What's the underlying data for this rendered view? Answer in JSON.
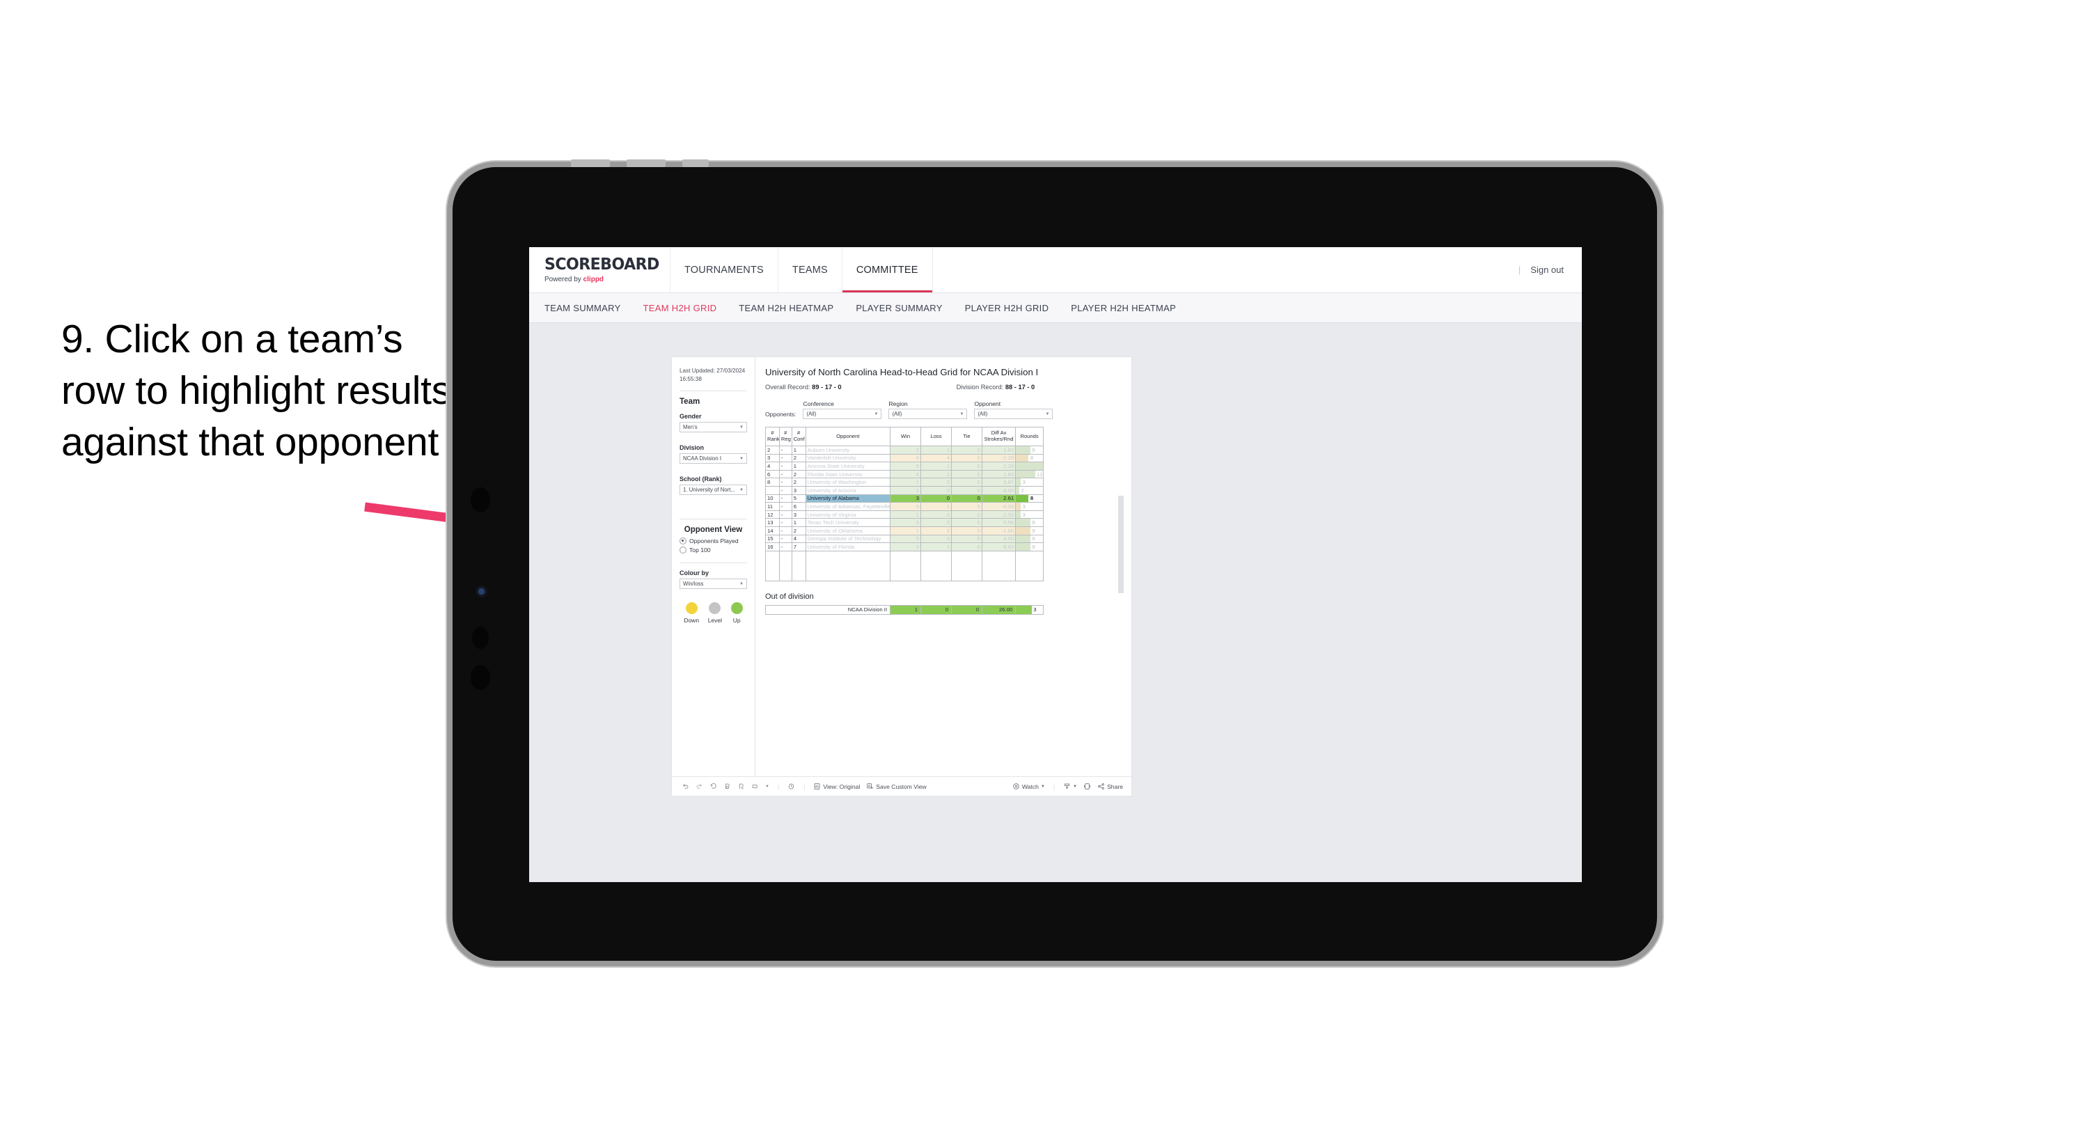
{
  "caption": {
    "text": "9. Click on a team’s row to highlight results against that opponent"
  },
  "colors": {
    "brand_pink": "#e8365d",
    "accent_nav": "#d93757",
    "select_blue": "#8fbdd6",
    "select_green": "#8ccc55",
    "win_green": "#e4eedd",
    "loss_cream": "#f8eed7",
    "arrow_pink": "#ed3a6b"
  },
  "appbar": {
    "logo_word": "SCOREBOARD",
    "logo_powered_prefix": "Powered by ",
    "logo_brand": "clippd",
    "nav": [
      {
        "label": "TOURNAMENTS",
        "active": false
      },
      {
        "label": "TEAMS",
        "active": false
      },
      {
        "label": "COMMITTEE",
        "active": true
      }
    ],
    "divider": "|",
    "signout": "Sign out"
  },
  "subnav": {
    "items": [
      {
        "label": "TEAM SUMMARY",
        "active": false
      },
      {
        "label": "TEAM H2H GRID",
        "active": true
      },
      {
        "label": "TEAM H2H HEATMAP",
        "active": false
      },
      {
        "label": "PLAYER SUMMARY",
        "active": false
      },
      {
        "label": "PLAYER H2H GRID",
        "active": false
      },
      {
        "label": "PLAYER H2H HEATMAP",
        "active": false
      }
    ]
  },
  "sidebar": {
    "last_updated_label": "Last Updated: 27/03/2024",
    "last_updated_time": "16:55:38",
    "team_heading": "Team",
    "gender_label": "Gender",
    "gender_value": "Men’s",
    "division_label": "Division",
    "division_value": "NCAA Division I",
    "school_label": "School (Rank)",
    "school_value": "1. University of Nort...",
    "opponent_view_heading": "Opponent View",
    "opponent_view_options": [
      {
        "label": "Opponents Played",
        "selected": true
      },
      {
        "label": "Top 100",
        "selected": false
      }
    ],
    "colour_by_label": "Colour by",
    "colour_by_value": "Win/loss",
    "legend": [
      {
        "label": "Down",
        "color": "#f2d33c"
      },
      {
        "label": "Level",
        "color": "#c4c4c4"
      },
      {
        "label": "Up",
        "color": "#8dc850"
      }
    ]
  },
  "viz": {
    "title": "University of North Carolina Head-to-Head Grid for NCAA Division I",
    "overall_record_label": "Overall Record: ",
    "overall_record_value": "89 - 17 - 0",
    "division_record_label": "Division Record: ",
    "division_record_value": "88 - 17 - 0",
    "opponents_label": "Opponents:",
    "filters": [
      {
        "caption": "Conference",
        "value": "(All)"
      },
      {
        "caption": "Region",
        "value": "(All)"
      },
      {
        "caption": "Opponent",
        "value": "(All)"
      }
    ],
    "out_of_division_heading": "Out of division"
  },
  "chart_data": {
    "type": "table",
    "title": "University of North Carolina Head-to-Head Grid for NCAA Division I",
    "columns": [
      "# Rank",
      "# Reg",
      "# Conf",
      "Opponent",
      "Win",
      "Loss",
      "Tie",
      "Diff Av Strokes/Rnd",
      "Rounds"
    ],
    "column_header_lines": [
      [
        "#",
        "Rank"
      ],
      [
        "#",
        "Reg"
      ],
      [
        "#",
        "Conf"
      ],
      [
        "Opponent",
        ""
      ],
      [
        "Win",
        ""
      ],
      [
        "Loss",
        ""
      ],
      [
        "Tie",
        ""
      ],
      [
        "Diff Av",
        "Strokes/Rnd"
      ],
      [
        "Rounds",
        ""
      ]
    ],
    "rounds_max": 17,
    "rows": [
      {
        "rank": "2",
        "reg": "-",
        "conf": "1",
        "opponent": "Auburn University",
        "win": "2",
        "loss": "1",
        "tie": "0",
        "diff": "1.67",
        "rounds": "9",
        "rounds_n": 9,
        "tone": "win",
        "selected": false
      },
      {
        "rank": "3",
        "reg": "-",
        "conf": "2",
        "opponent": "Vanderbilt University",
        "win": "0",
        "loss": "4",
        "tie": "0",
        "diff": "-2.29",
        "rounds": "8",
        "rounds_n": 8,
        "tone": "loss",
        "selected": false
      },
      {
        "rank": "4",
        "reg": "-",
        "conf": "1",
        "opponent": "Arizona State University",
        "win": "5",
        "loss": "1",
        "tie": "0",
        "diff": "2.28",
        "rounds": "17",
        "rounds_n": 17,
        "tone": "win",
        "selected": false
      },
      {
        "rank": "6",
        "reg": "-",
        "conf": "2",
        "opponent": "Florida State University",
        "win": "4",
        "loss": "2",
        "tie": "0",
        "diff": "1.83",
        "rounds": "12",
        "rounds_n": 12,
        "tone": "win",
        "selected": false
      },
      {
        "rank": "8",
        "reg": "-",
        "conf": "2",
        "opponent": "University of Washington",
        "win": "1",
        "loss": "0",
        "tie": "0",
        "diff": "3.67",
        "rounds": "3",
        "rounds_n": 3,
        "tone": "win",
        "selected": false
      },
      {
        "rank": "",
        "reg": "-",
        "conf": "3",
        "opponent": "University of Arizona",
        "win": "1",
        "loss": "0",
        "tie": "0",
        "diff": "9.00",
        "rounds": "2",
        "rounds_n": 2,
        "tone": "win",
        "selected": false
      },
      {
        "rank": "10",
        "reg": "-",
        "conf": "5",
        "opponent": "University of Alabama",
        "win": "3",
        "loss": "0",
        "tie": "0",
        "diff": "2.61",
        "rounds": "8",
        "rounds_n": 8,
        "tone": "win",
        "selected": true
      },
      {
        "rank": "11",
        "reg": "-",
        "conf": "6",
        "opponent": "University of Arkansas, Fayetteville",
        "win": "0",
        "loss": "1",
        "tie": "0",
        "diff": "-4.33",
        "rounds": "3",
        "rounds_n": 3,
        "tone": "loss",
        "selected": false
      },
      {
        "rank": "12",
        "reg": "-",
        "conf": "3",
        "opponent": "University of Virginia",
        "win": "1",
        "loss": "0",
        "tie": "0",
        "diff": "2.33",
        "rounds": "3",
        "rounds_n": 3,
        "tone": "win",
        "selected": false
      },
      {
        "rank": "13",
        "reg": "-",
        "conf": "1",
        "opponent": "Texas Tech University",
        "win": "3",
        "loss": "0",
        "tie": "0",
        "diff": "5.56",
        "rounds": "9",
        "rounds_n": 9,
        "tone": "win",
        "selected": false
      },
      {
        "rank": "14",
        "reg": "-",
        "conf": "2",
        "opponent": "University of Oklahoma",
        "win": "1",
        "loss": "2",
        "tie": "0",
        "diff": "-1.00",
        "rounds": "9",
        "rounds_n": 9,
        "tone": "loss",
        "selected": false
      },
      {
        "rank": "15",
        "reg": "-",
        "conf": "4",
        "opponent": "Georgia Institute of Technology",
        "win": "5",
        "loss": "0",
        "tie": "0",
        "diff": "4.50",
        "rounds": "9",
        "rounds_n": 9,
        "tone": "win",
        "selected": false
      },
      {
        "rank": "16",
        "reg": "-",
        "conf": "7",
        "opponent": "University of Florida",
        "win": "3",
        "loss": "1",
        "tie": "0",
        "diff": "6.62",
        "rounds": "9",
        "rounds_n": 9,
        "tone": "win",
        "selected": false
      }
    ],
    "out_of_division": {
      "name": "NCAA Division II",
      "win": "1",
      "loss": "0",
      "tie": "0",
      "diff": "26.00",
      "rounds": "3",
      "rounds_n": 3
    }
  },
  "toolbar": {
    "view_label": "View: Original",
    "save_label": "Save Custom View",
    "watch_label": "Watch",
    "share_label": "Share",
    "separator": "|"
  }
}
